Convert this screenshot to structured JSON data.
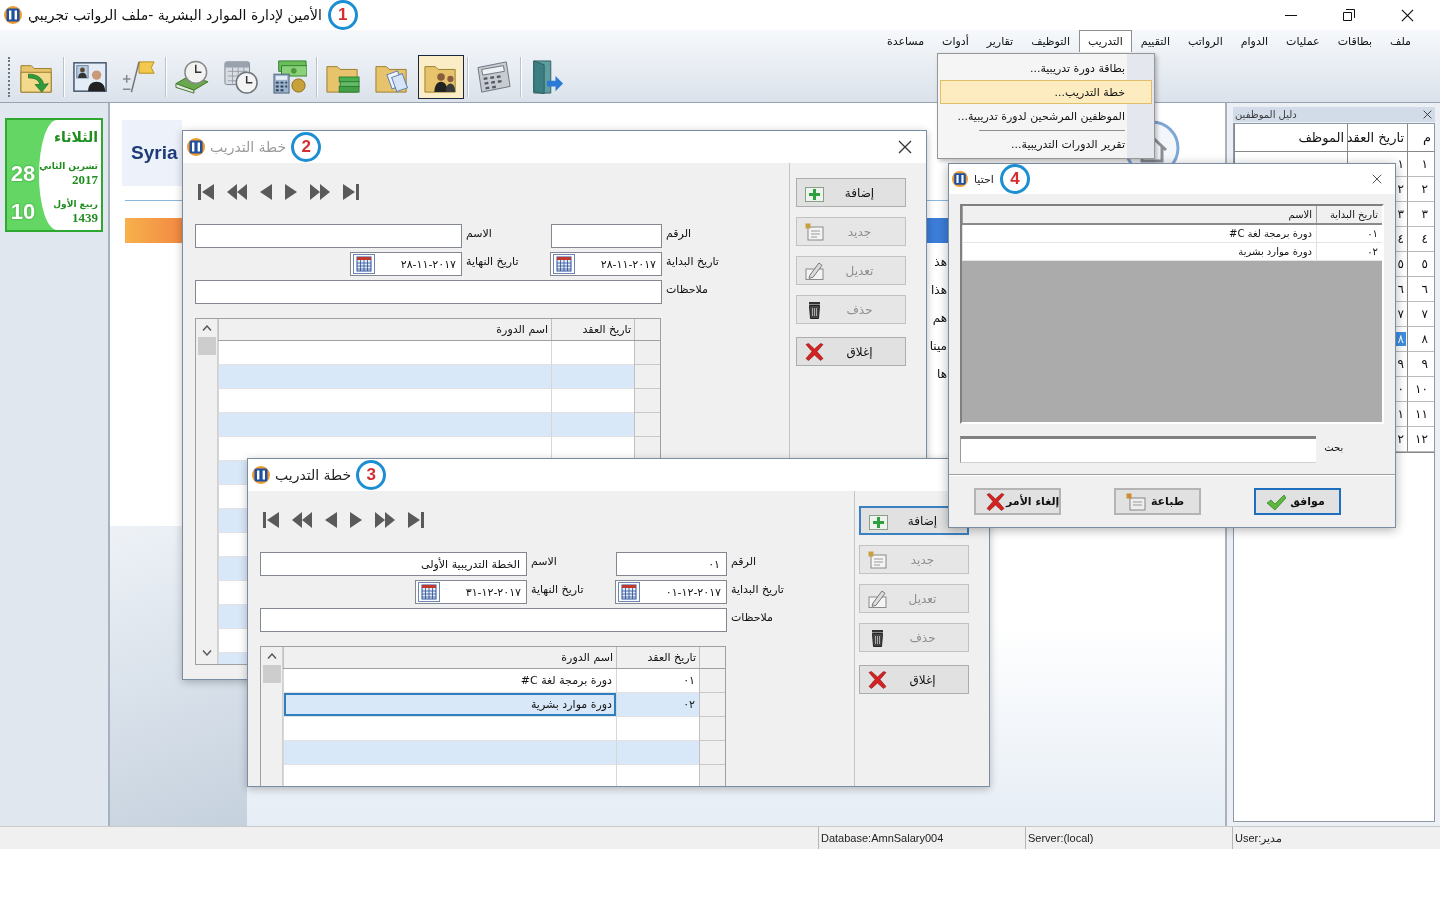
{
  "window": {
    "title": "الأمين لإدارة الموارد البشرية -ملف الرواتب تجريبي",
    "callout": "1"
  },
  "menu_bar": [
    {
      "label": "ملف",
      "selected": false
    },
    {
      "label": "بطاقات",
      "selected": false
    },
    {
      "label": "عمليات",
      "selected": false
    },
    {
      "label": "الدوام",
      "selected": false
    },
    {
      "label": "الرواتب",
      "selected": false
    },
    {
      "label": "التقييم",
      "selected": false
    },
    {
      "label": "التدريب",
      "selected": true
    },
    {
      "label": "التوظيف",
      "selected": false
    },
    {
      "label": "تقارير",
      "selected": false
    },
    {
      "label": "أدوات",
      "selected": false
    },
    {
      "label": "مساعدة",
      "selected": false
    }
  ],
  "toolbar": {
    "groups": [
      [
        {
          "selected": false
        }
      ],
      [
        {
          "selected": false
        },
        {
          "selected": false
        }
      ],
      [
        {
          "selected": false
        },
        {
          "selected": false
        },
        {
          "selected": false
        }
      ],
      [
        {
          "selected": false
        },
        {
          "selected": false
        },
        {
          "selected": true
        }
      ],
      [
        {
          "selected": false
        }
      ],
      [
        {
          "selected": false
        }
      ]
    ]
  },
  "open_menu": {
    "items": [
      {
        "label": "بطاقة دورة تدريبية...",
        "selected": false,
        "separator_before": false
      },
      {
        "label": "خطة التدريب...",
        "selected": true,
        "separator_before": false
      },
      {
        "label": "الموظفين المرشحين لدورة تدريبية...",
        "selected": false,
        "separator_before": false
      },
      {
        "label": "تقرير الدورات التدريبية...",
        "selected": false,
        "separator_before": true
      }
    ]
  },
  "calendar": {
    "weekday": "الثلاثاء",
    "day": "28",
    "month": "تشرين الثاني",
    "year": "2017",
    "hijri_day": "10",
    "hijri_month": "ربيع الأول",
    "hijri_year": "1439"
  },
  "home_page": {
    "logo_text": "Syria",
    "text_fragments": [
      "هذ",
      "هذا",
      "هم",
      "مينا",
      "ها"
    ]
  },
  "employee_panel": {
    "title": "دليل الموظفين",
    "columns": [
      "م",
      "تاريخ العقد",
      "الموظف"
    ],
    "rows": [
      {
        "number": "١",
        "contract_date": "١",
        "selected": false
      },
      {
        "number": "٢",
        "contract_date": "٢",
        "selected": false
      },
      {
        "number": "٣",
        "contract_date": "٣",
        "selected": false
      },
      {
        "number": "٤",
        "contract_date": "٤",
        "selected": false
      },
      {
        "number": "٥",
        "contract_date": "٥",
        "selected": false
      },
      {
        "number": "٦",
        "contract_date": "٦",
        "selected": false
      },
      {
        "number": "٧",
        "contract_date": "٧",
        "selected": false
      },
      {
        "number": "٨",
        "contract_date": "٨",
        "selected": true
      },
      {
        "number": "٩",
        "contract_date": "٩",
        "selected": false
      },
      {
        "number": "١٠",
        "contract_date": "٠",
        "selected": false
      },
      {
        "number": "١١",
        "contract_date": "١",
        "selected": false
      },
      {
        "number": "١٢",
        "contract_date": "٢",
        "selected": false
      }
    ]
  },
  "training_plan_windows": [
    {
      "title": "خطة التدريب",
      "callout": "2",
      "active": false,
      "close_button_visible": true,
      "fields": {
        "number": {
          "label": "الرقم"
        },
        "name": {
          "label": "الاسم"
        },
        "start_date": {
          "label": "تاريخ البداية",
          "value": "٢٨-١١-٢٠١٧"
        },
        "end_date": {
          "label": "تاريخ النهاية",
          "value": "٢٨-١١-٢٠١٧"
        },
        "notes": {
          "label": "ملاحظات"
        }
      },
      "grid": {
        "columns": [
          "تاريخ العقد",
          "اسم الدورة"
        ]
      },
      "buttons": [
        {
          "label": "إضافة",
          "disabled": false,
          "focused": false
        },
        {
          "label": "جديد",
          "disabled": true,
          "focused": false
        },
        {
          "label": "تعديل",
          "disabled": true,
          "focused": false
        },
        {
          "label": "حذف",
          "disabled": true,
          "focused": false
        },
        {
          "label": "إغلاق",
          "disabled": false,
          "focused": false
        }
      ]
    },
    {
      "title": "خطة التدريب",
      "callout": "3",
      "active": true,
      "close_button_visible": false,
      "fields": {
        "number": {
          "label": "الرقم",
          "value": "٠١"
        },
        "name": {
          "label": "الاسم",
          "value": "الخطة التدريبية الأولى"
        },
        "start_date": {
          "label": "تاريخ البداية",
          "value": "٠١-١٢-٢٠١٧"
        },
        "end_date": {
          "label": "تاريخ النهاية",
          "value": "٣١-١٢-٢٠١٧"
        },
        "notes": {
          "label": "ملاحظات"
        }
      },
      "grid": {
        "columns": [
          "تاريخ العقد",
          "اسم الدورة"
        ],
        "rows": [
          {
            "number": "٠١",
            "course": "دورة برمجة لغة C#",
            "selected": false
          },
          {
            "number": "٠٢",
            "course": "دورة موارد بشرية",
            "selected": true
          }
        ]
      },
      "buttons": [
        {
          "label": "إضافة",
          "disabled": false,
          "focused": true
        },
        {
          "label": "جديد",
          "disabled": true,
          "focused": false
        },
        {
          "label": "تعديل",
          "disabled": true,
          "focused": false
        },
        {
          "label": "حذف",
          "disabled": true,
          "focused": false
        },
        {
          "label": "إغلاق",
          "disabled": false,
          "focused": false
        }
      ]
    }
  ],
  "picker_dialog": {
    "title": "احتيا",
    "callout": "4",
    "columns": [
      "تاريخ البداية",
      "الاسم"
    ],
    "rows": [
      {
        "number": "٠١",
        "name": "دورة برمجة لغة C#"
      },
      {
        "number": "٠٢",
        "name": "دورة موارد بشرية"
      }
    ],
    "search": {
      "label": "بحث"
    },
    "buttons": [
      {
        "label": "موافق",
        "focused": true
      },
      {
        "label": "طباعة",
        "focused": false
      },
      {
        "label": "إلغاء الأمر",
        "focused": false
      }
    ]
  },
  "status_bar": [
    "User:مدير",
    "Server:(local)",
    "Database:AmnSalary004"
  ]
}
